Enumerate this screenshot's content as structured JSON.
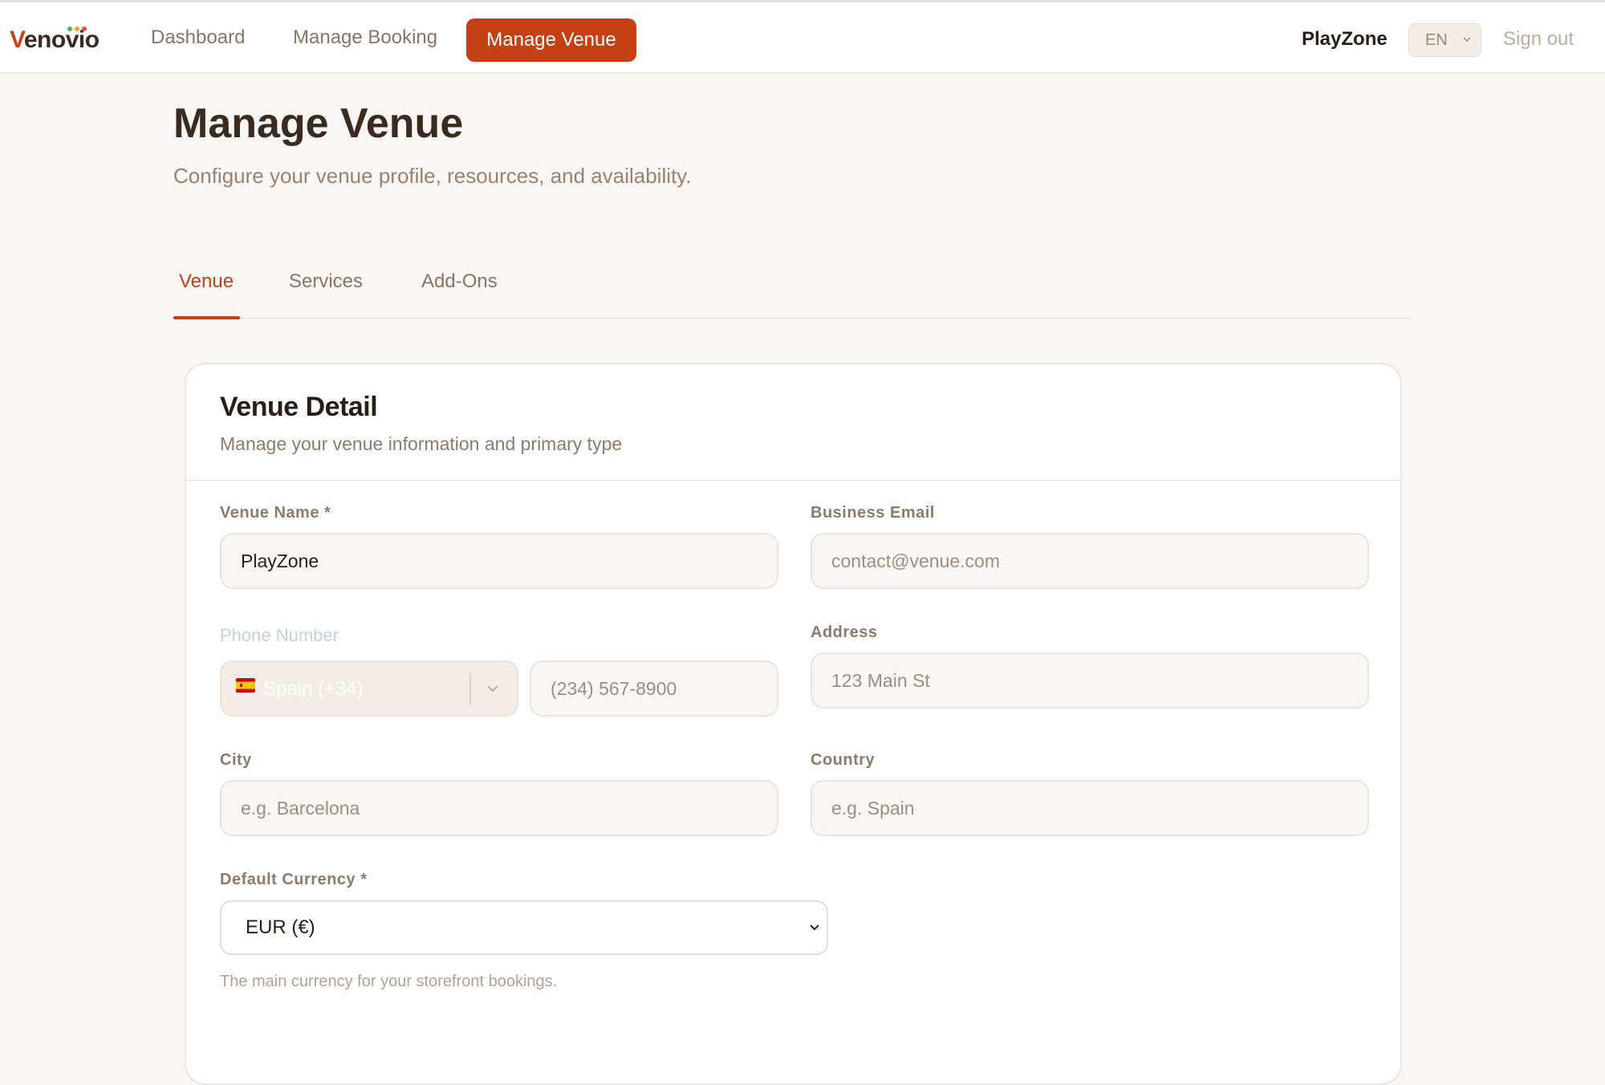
{
  "brand": {
    "name_first": "V",
    "name_rest": "enovio",
    "dot_colors": [
      "#3fb950",
      "#f0a21a",
      "#e5484d"
    ]
  },
  "nav": {
    "items": [
      {
        "label": "Dashboard"
      },
      {
        "label": "Manage Booking"
      },
      {
        "label": "Manage Venue",
        "active": true
      }
    ],
    "venue_name": "PlayZone",
    "language": "EN",
    "sign_out": "Sign out"
  },
  "header": {
    "title": "Manage Venue",
    "subtitle": "Configure your venue profile, resources, and availability."
  },
  "tabs": [
    {
      "label": "Venue",
      "active": true
    },
    {
      "label": "Services"
    },
    {
      "label": "Add-Ons"
    }
  ],
  "card": {
    "title": "Venue Detail",
    "subtitle": "Manage your venue information and primary type",
    "fields": {
      "venue_name": {
        "label": "Venue Name *",
        "value": "PlayZone"
      },
      "business_email": {
        "label": "Business Email",
        "placeholder": "contact@venue.com"
      },
      "phone": {
        "label": "Phone Number",
        "country": "Spain (+34)",
        "placeholder": "(234) 567-8900"
      },
      "address": {
        "label": "Address",
        "placeholder": "123 Main St"
      },
      "city": {
        "label": "City",
        "placeholder": "e.g. Barcelona"
      },
      "country": {
        "label": "Country",
        "placeholder": "e.g. Spain"
      },
      "currency": {
        "label": "Default Currency *",
        "value": "EUR (€)",
        "help": "The main currency for your storefront bookings."
      }
    }
  },
  "colors": {
    "accent": "#c73f15",
    "background": "#f9f6f3",
    "text_dark": "#3b2a20"
  }
}
